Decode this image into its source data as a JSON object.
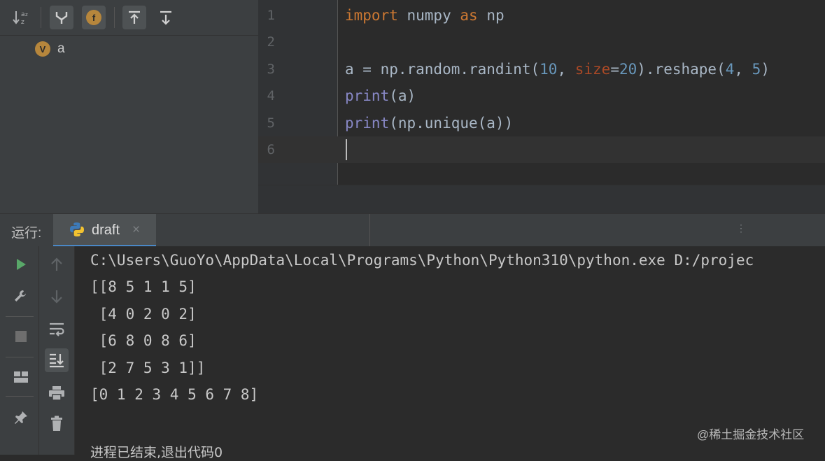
{
  "structure": {
    "tree": [
      {
        "badge": "V",
        "label": "a"
      }
    ]
  },
  "editor": {
    "lines": [
      {
        "num": "1",
        "tokens": [
          [
            "kw",
            "import"
          ],
          [
            "plain",
            " numpy "
          ],
          [
            "kw",
            "as"
          ],
          [
            "plain",
            " np"
          ]
        ]
      },
      {
        "num": "2",
        "tokens": []
      },
      {
        "num": "3",
        "tokens": [
          [
            "plain",
            "a = np.random.randint("
          ],
          [
            "num",
            "10"
          ],
          [
            "plain",
            ", "
          ],
          [
            "param",
            "size"
          ],
          [
            "plain",
            "="
          ],
          [
            "num",
            "20"
          ],
          [
            "plain",
            ").reshape("
          ],
          [
            "num",
            "4"
          ],
          [
            "plain",
            ", "
          ],
          [
            "num",
            "5"
          ],
          [
            "plain",
            ")"
          ]
        ]
      },
      {
        "num": "4",
        "tokens": [
          [
            "fn",
            "print"
          ],
          [
            "plain",
            "(a)"
          ]
        ]
      },
      {
        "num": "5",
        "tokens": [
          [
            "fn",
            "print"
          ],
          [
            "plain",
            "(np.unique(a))"
          ]
        ]
      },
      {
        "num": "6",
        "tokens": []
      }
    ],
    "current_line": 6
  },
  "run": {
    "label": "运行:",
    "tab_name": "draft",
    "tab_close": "×",
    "output": [
      "C:\\Users\\GuoYo\\AppData\\Local\\Programs\\Python\\Python310\\python.exe D:/projec",
      "[[8 5 1 1 5]",
      " [4 0 2 0 2]",
      " [6 8 0 8 6]",
      " [2 7 5 3 1]]",
      "[0 1 2 3 4 5 6 7 8]"
    ],
    "exit_message": "进程已结束,退出代码0"
  },
  "watermark": "@稀土掘金技术社区",
  "colors": {
    "keyword": "#cc7832",
    "builtin": "#8888c6",
    "number": "#6897bb",
    "param": "#aa4926",
    "text": "#a9b7c6",
    "run_green": "#59a869",
    "badge": "#b6863c"
  },
  "icons": {
    "toolbar": [
      "sort-alpha-icon",
      "show-inherited-icon",
      "show-fields-icon",
      "expand-all-icon",
      "collapse-all-icon"
    ],
    "run_left": [
      "rerun-icon",
      "settings-wrench-icon",
      "stop-icon",
      "layout-icon",
      "pin-icon"
    ],
    "run_left2": [
      "up-arrow-icon",
      "down-arrow-icon",
      "soft-wrap-icon",
      "scroll-to-end-icon",
      "print-icon",
      "trash-icon"
    ]
  }
}
